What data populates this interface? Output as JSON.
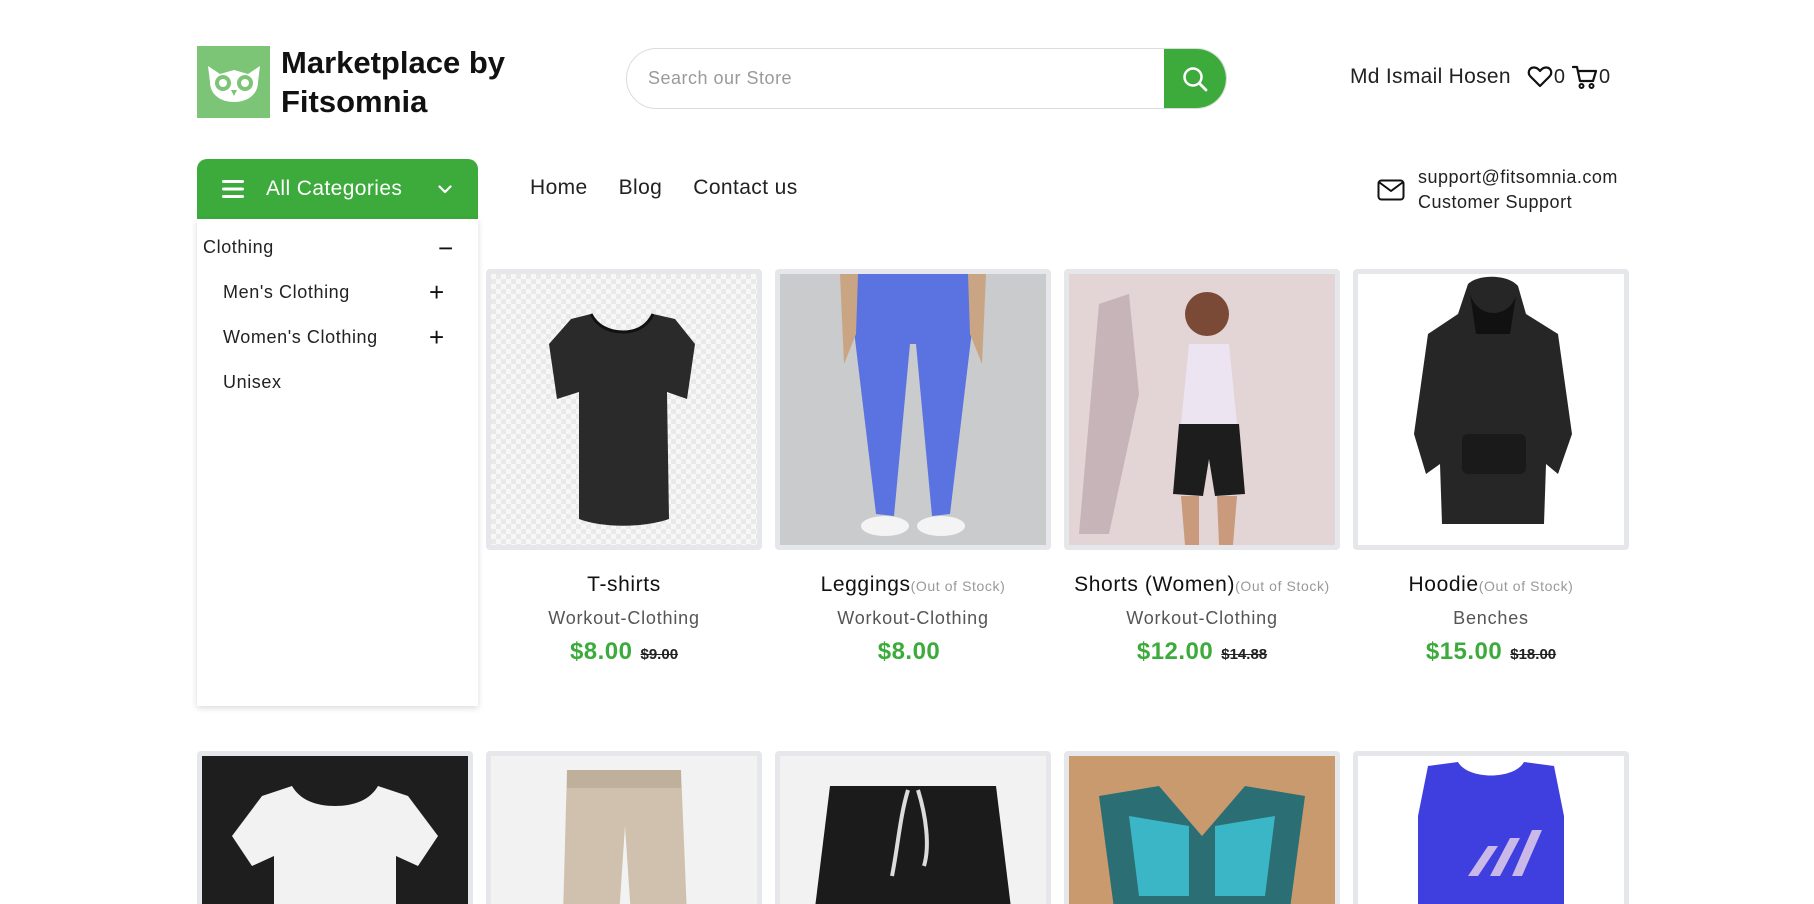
{
  "header": {
    "brand": "Marketplace by Fitsomnia",
    "search_placeholder": "Search our Store",
    "user_name": "Md Ismail Hosen",
    "wishlist_count": "0",
    "cart_count": "0"
  },
  "category_button": {
    "label": "All Categories"
  },
  "nav": {
    "home": "Home",
    "blog": "Blog",
    "contact": "Contact us"
  },
  "support": {
    "email": "support@fitsomnia.com",
    "label": "Customer Support"
  },
  "sidebar": {
    "items": [
      {
        "label": "Clothing",
        "toggle": "−"
      },
      {
        "label": "Men's Clothing",
        "toggle": "+"
      },
      {
        "label": "Women's Clothing",
        "toggle": "+"
      },
      {
        "label": "Unisex",
        "toggle": ""
      }
    ]
  },
  "products": [
    {
      "name": "T-shirts",
      "stock_note": "",
      "category": "Workout-Clothing",
      "price": "$8.00",
      "old_price": "$9.00"
    },
    {
      "name": "Leggings",
      "stock_note": "(Out of Stock)",
      "category": "Workout-Clothing",
      "price": "$8.00",
      "old_price": ""
    },
    {
      "name": "Shorts (Women)",
      "stock_note": "(Out of Stock)",
      "category": "Workout-Clothing",
      "price": "$12.00",
      "old_price": "$14.88"
    },
    {
      "name": "Hoodie",
      "stock_note": "(Out of Stock)",
      "category": "Benches",
      "price": "$15.00",
      "old_price": "$18.00"
    }
  ],
  "colors": {
    "accent": "#3cab3b",
    "logo_bg": "#7cc576",
    "border": "#e5e7eb"
  }
}
